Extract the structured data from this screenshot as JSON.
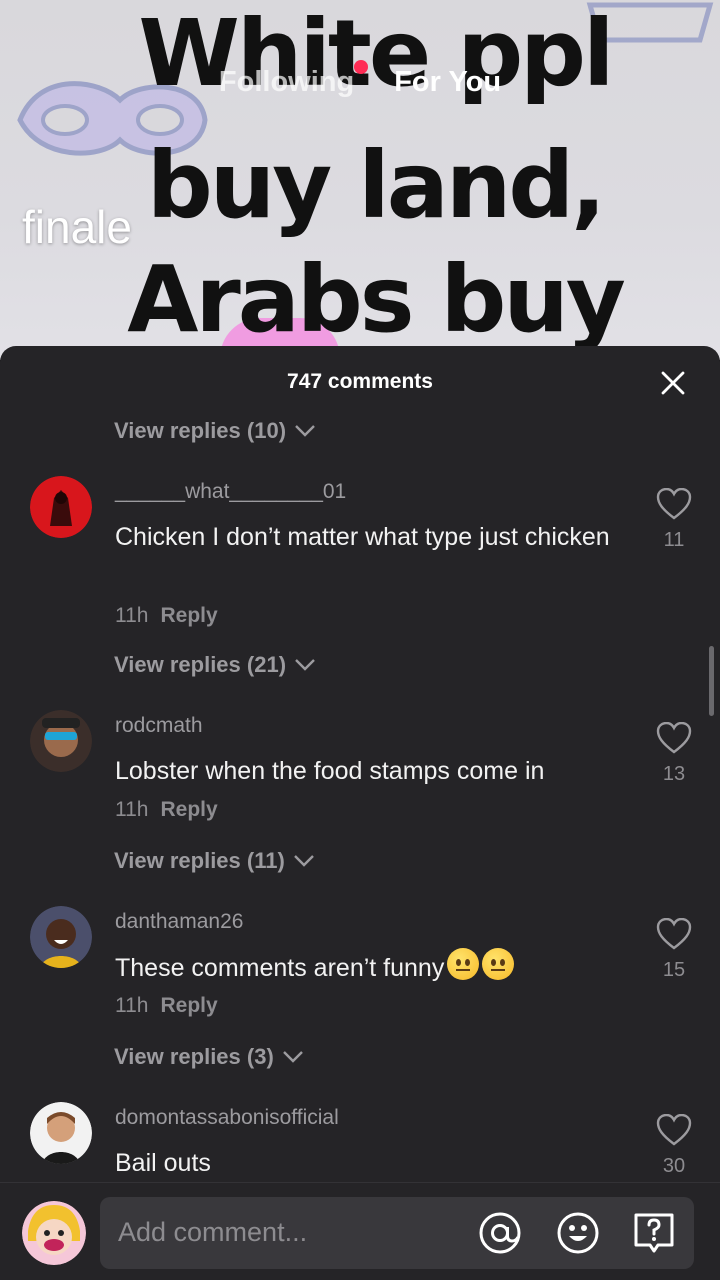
{
  "video": {
    "meme_lines": [
      "White ppl",
      "buy land,",
      "Arabs buy"
    ],
    "caption": "finale",
    "tabs": {
      "following": "Following",
      "for_you": "For You"
    }
  },
  "comments_panel": {
    "title": "747 comments",
    "top_view_replies": "View replies (10)",
    "comments": [
      {
        "username": "______what________01",
        "text": "Chicken I don’t matter what type just chicken",
        "time": "11h",
        "reply_label": "Reply",
        "likes": "11",
        "view_replies": "View replies (21)"
      },
      {
        "username": "rodcmath",
        "text": "Lobster when the food stamps come in",
        "time": "11h",
        "reply_label": "Reply",
        "likes": "13",
        "view_replies": "View replies (11)"
      },
      {
        "username": "danthaman26",
        "text": "These comments aren’t funny",
        "emoji": "😐😐",
        "time": "11h",
        "reply_label": "Reply",
        "likes": "15",
        "view_replies": "View replies (3)"
      },
      {
        "username": "domontassabonisofficial",
        "text": "Bail outs",
        "likes": "30"
      }
    ]
  },
  "input_bar": {
    "placeholder": "Add comment...",
    "icons": [
      "at-sign-icon",
      "emoji-icon",
      "question-icon"
    ]
  },
  "colors": {
    "panel_bg": "#252427",
    "accent_dot": "#ff2c55",
    "muted_text": "#9c9b9f"
  }
}
